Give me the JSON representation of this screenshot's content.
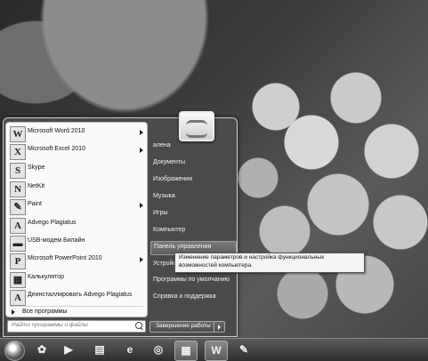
{
  "start_menu": {
    "programs": [
      {
        "label": "Microsoft Word 2010",
        "icon": "word-icon",
        "glyph": "W",
        "submenu": true
      },
      {
        "label": "Microsoft Excel 2010",
        "icon": "excel-icon",
        "glyph": "X",
        "submenu": true
      },
      {
        "label": "Skype",
        "icon": "skype-icon",
        "glyph": "S",
        "submenu": false
      },
      {
        "label": "NetKit",
        "icon": "netkit-icon",
        "glyph": "N",
        "submenu": false
      },
      {
        "label": "Paint",
        "icon": "paint-icon",
        "glyph": "✎",
        "submenu": true
      },
      {
        "label": "Advego Plagiatus",
        "icon": "advego-icon",
        "glyph": "A",
        "submenu": false
      },
      {
        "label": "USB-модем Билайн",
        "icon": "modem-icon",
        "glyph": "▬",
        "submenu": false
      },
      {
        "label": "Microsoft PowerPoint 2010",
        "icon": "powerpoint-icon",
        "glyph": "P",
        "submenu": true
      },
      {
        "label": "Калькулятор",
        "icon": "calculator-icon",
        "glyph": "▦",
        "submenu": false
      },
      {
        "label": "Деинсталлировать Advego Plagiatus",
        "icon": "uninstall-icon",
        "glyph": "A",
        "submenu": false
      }
    ],
    "all_programs": "Все программы",
    "search_placeholder": "Найти программы и файлы",
    "right_items": [
      {
        "label": "алена"
      },
      {
        "label": "Документы"
      },
      {
        "label": "Изображения"
      },
      {
        "label": "Музыка"
      },
      {
        "label": "Игры"
      },
      {
        "label": "Компьютер"
      },
      {
        "label": "Панель управления"
      },
      {
        "label": "Устройс"
      },
      {
        "label": "Программы по умолчанию"
      },
      {
        "label": "Справка и поддержка"
      }
    ],
    "shutdown_label": "Завершение работы",
    "tooltip": "Изменение параметров и настройка функциональных возможностей компьютера."
  },
  "taskbar": {
    "items": [
      {
        "name": "taskbar-flower-icon",
        "glyph": "✿"
      },
      {
        "name": "taskbar-media-player-icon",
        "glyph": "▶"
      },
      {
        "name": "taskbar-explorer-icon",
        "glyph": "▤"
      },
      {
        "name": "taskbar-ie-icon",
        "glyph": "e"
      },
      {
        "name": "taskbar-app-icon",
        "glyph": "◎"
      },
      {
        "name": "taskbar-calendar-icon",
        "glyph": "▦"
      },
      {
        "name": "taskbar-word-icon",
        "glyph": "W"
      },
      {
        "name": "taskbar-paint-icon",
        "glyph": "✎"
      }
    ]
  }
}
